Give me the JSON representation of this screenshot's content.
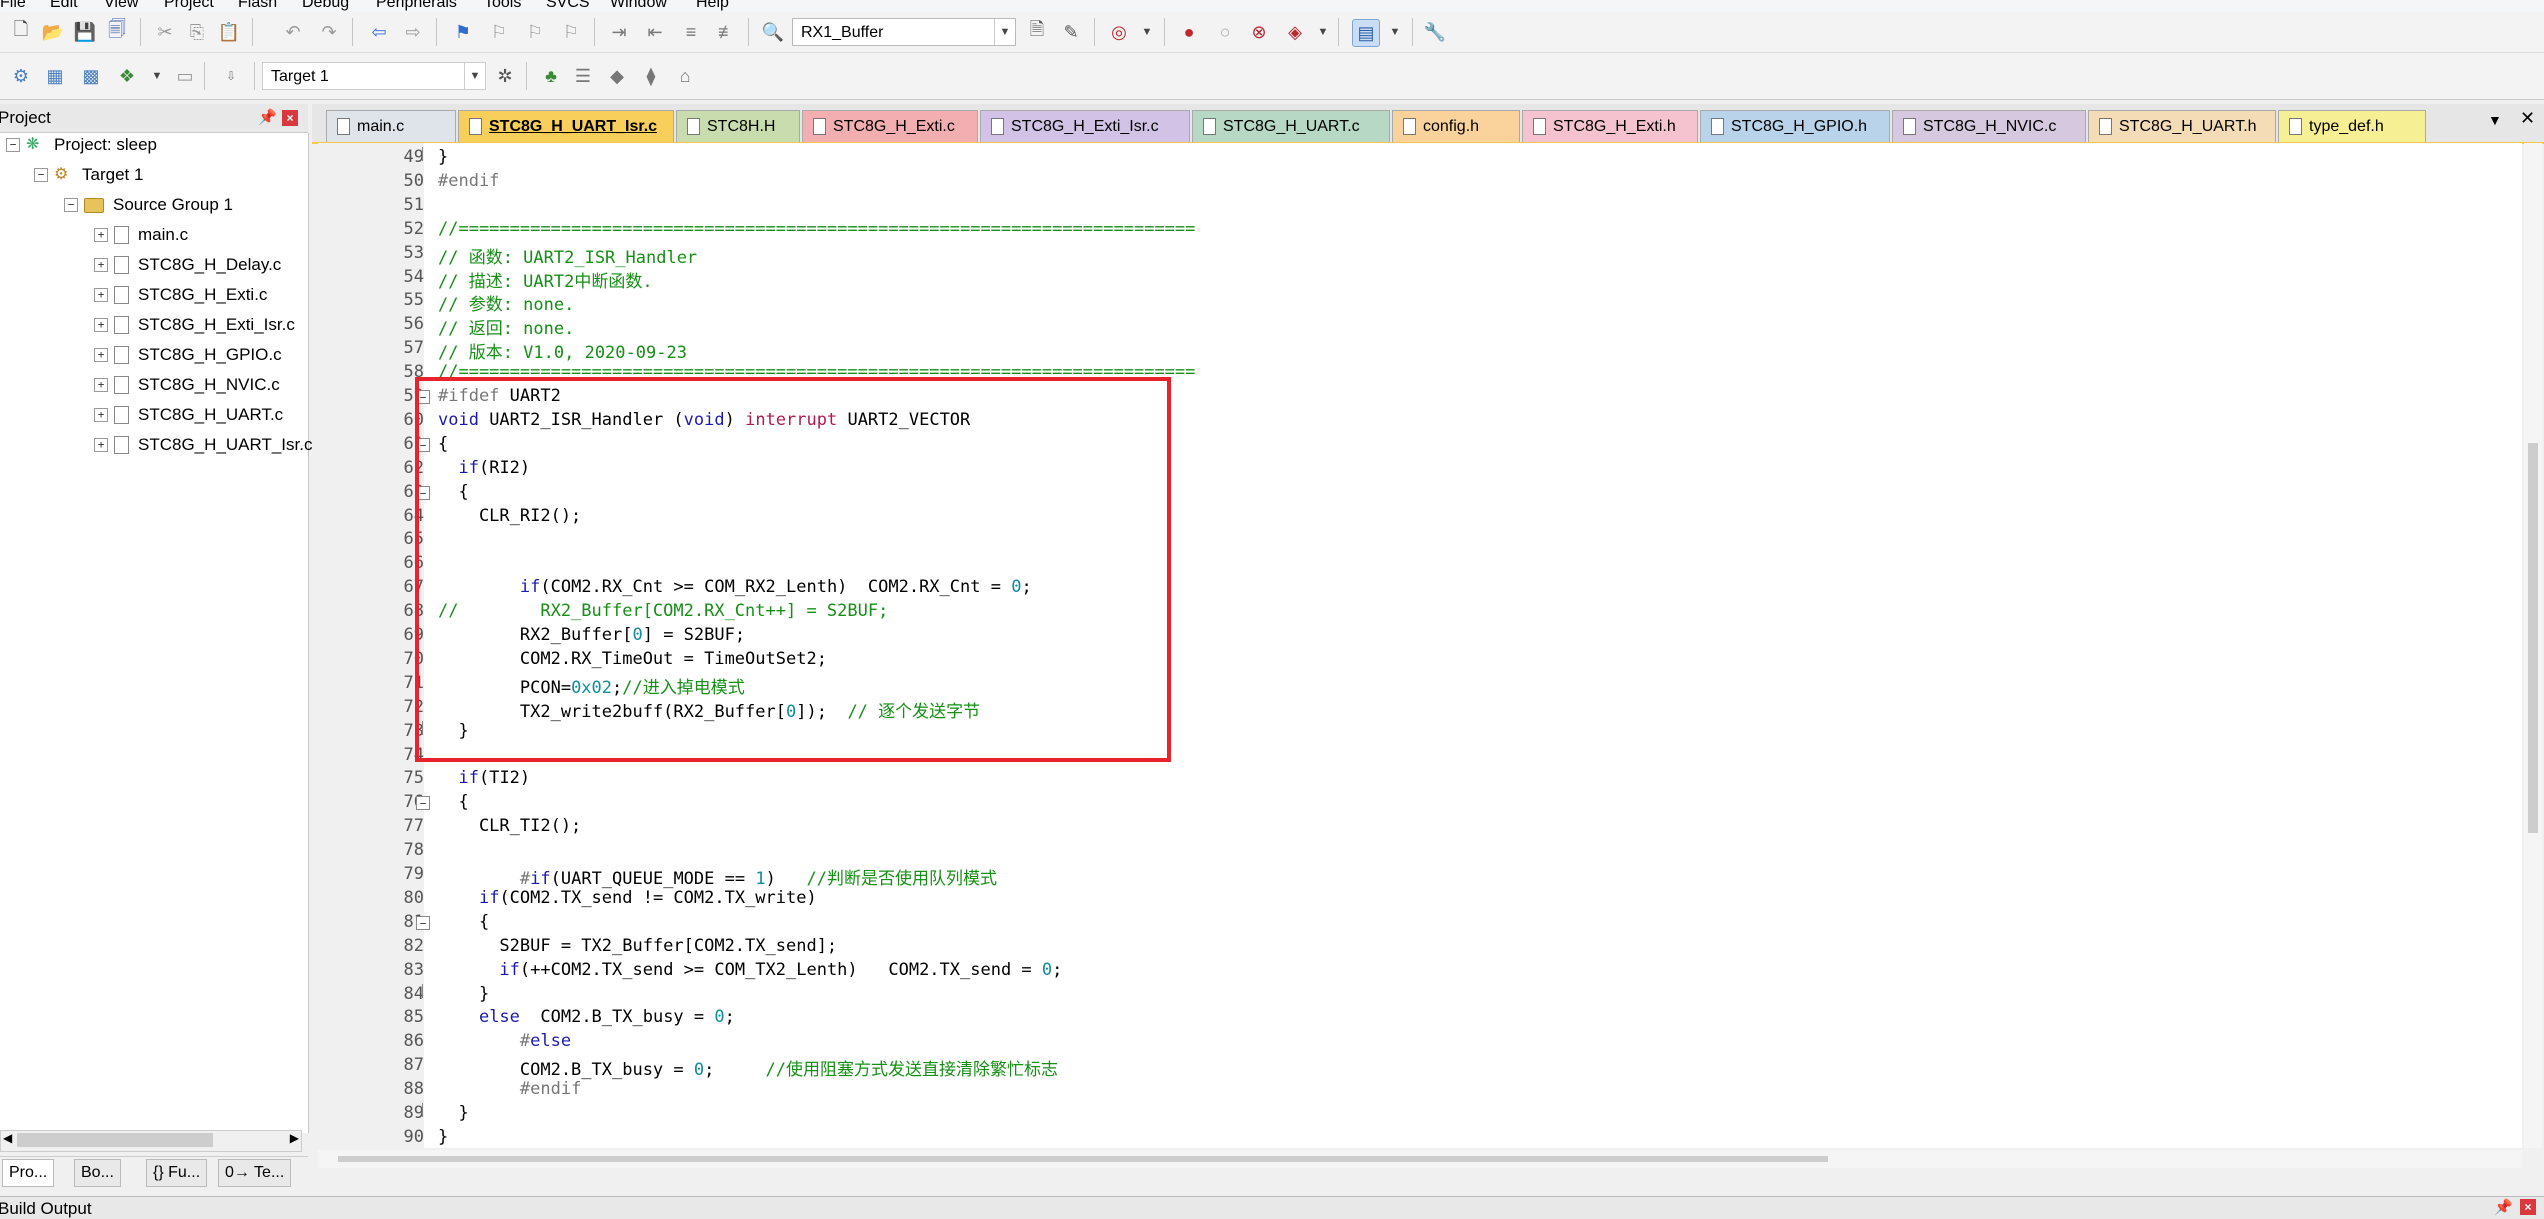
{
  "menu": [
    "File",
    "Edit",
    "View",
    "Project",
    "Flash",
    "Debug",
    "Peripherals",
    "Tools",
    "SVCS",
    "Window",
    "Help"
  ],
  "toolbar": {
    "find_combo_value": "RX1_Buffer",
    "target_combo_value": "Target 1"
  },
  "project_panel": {
    "title": "Project",
    "tree": [
      {
        "label": "Project: sleep",
        "kind": "project",
        "level": 0
      },
      {
        "label": "Target 1",
        "kind": "target",
        "level": 1
      },
      {
        "label": "Source Group 1",
        "kind": "group",
        "level": 2
      },
      {
        "label": "main.c",
        "kind": "file",
        "level": 3
      },
      {
        "label": "STC8G_H_Delay.c",
        "kind": "file",
        "level": 3
      },
      {
        "label": "STC8G_H_Exti.c",
        "kind": "file",
        "level": 3
      },
      {
        "label": "STC8G_H_Exti_Isr.c",
        "kind": "file",
        "level": 3
      },
      {
        "label": "STC8G_H_GPIO.c",
        "kind": "file",
        "level": 3
      },
      {
        "label": "STC8G_H_NVIC.c",
        "kind": "file",
        "level": 3
      },
      {
        "label": "STC8G_H_UART.c",
        "kind": "file",
        "level": 3
      },
      {
        "label": "STC8G_H_UART_Isr.c",
        "kind": "file",
        "level": 3
      }
    ],
    "bottom_tabs": [
      "Pro...",
      "Bo...",
      "{} Fu...",
      "0→ Te..."
    ]
  },
  "editor_tabs": [
    {
      "label": "main.c",
      "color": "#dfe3ea",
      "active": false
    },
    {
      "label": "STC8G_H_UART_Isr.c",
      "color": "#f7cf5a",
      "active": true
    },
    {
      "label": "STC8H.H",
      "color": "#c9dcae",
      "active": false
    },
    {
      "label": "STC8G_H_Exti.c",
      "color": "#f2aeb0",
      "active": false
    },
    {
      "label": "STC8G_H_Exti_Isr.c",
      "color": "#d2c2e6",
      "active": false
    },
    {
      "label": "STC8G_H_UART.c",
      "color": "#b7d8c4",
      "active": false
    },
    {
      "label": "config.h",
      "color": "#f9d29c",
      "active": false
    },
    {
      "label": "STC8G_H_Exti.h",
      "color": "#f4c3cf",
      "active": false
    },
    {
      "label": "STC8G_H_GPIO.h",
      "color": "#b9d3ea",
      "active": false
    },
    {
      "label": "STC8G_H_NVIC.c",
      "color": "#d6c8df",
      "active": false
    },
    {
      "label": "STC8G_H_UART.h",
      "color": "#f4dcb6",
      "active": false
    },
    {
      "label": "type_def.h",
      "color": "#f6ef93",
      "active": false
    }
  ],
  "code_lines": [
    {
      "n": "49",
      "t": "}"
    },
    {
      "n": "50",
      "t": "#endif"
    },
    {
      "n": "51",
      "t": ""
    },
    {
      "n": "52",
      "t": "//========================================================================"
    },
    {
      "n": "53",
      "t": "// 函数: UART2_ISR_Handler"
    },
    {
      "n": "54",
      "t": "// 描述: UART2中断函数."
    },
    {
      "n": "55",
      "t": "// 参数: none."
    },
    {
      "n": "56",
      "t": "// 返回: none."
    },
    {
      "n": "57",
      "t": "// 版本: V1.0, 2020-09-23"
    },
    {
      "n": "58",
      "t": "//========================================================================"
    },
    {
      "n": "59",
      "t": "#ifdef UART2"
    },
    {
      "n": "60",
      "t": "void UART2_ISR_Handler (void) interrupt UART2_VECTOR"
    },
    {
      "n": "61",
      "t": "{"
    },
    {
      "n": "62",
      "t": "  if(RI2)"
    },
    {
      "n": "63",
      "t": "  {"
    },
    {
      "n": "64",
      "t": "    CLR_RI2();"
    },
    {
      "n": "65",
      "t": ""
    },
    {
      "n": "66",
      "t": ""
    },
    {
      "n": "67",
      "t": "        if(COM2.RX_Cnt >= COM_RX2_Lenth)  COM2.RX_Cnt = 0;"
    },
    {
      "n": "68",
      "t": "//        RX2_Buffer[COM2.RX_Cnt++] = S2BUF;"
    },
    {
      "n": "69",
      "t": "        RX2_Buffer[0] = S2BUF;"
    },
    {
      "n": "70",
      "t": "        COM2.RX_TimeOut = TimeOutSet2;"
    },
    {
      "n": "71",
      "t": "        PCON=0x02;//进入掉电模式"
    },
    {
      "n": "72",
      "t": "        TX2_write2buff(RX2_Buffer[0]);  // 逐个发送字节"
    },
    {
      "n": "73",
      "t": "  }"
    },
    {
      "n": "74",
      "t": ""
    },
    {
      "n": "75",
      "t": "  if(TI2)"
    },
    {
      "n": "76",
      "t": "  {"
    },
    {
      "n": "77",
      "t": "    CLR_TI2();"
    },
    {
      "n": "78",
      "t": ""
    },
    {
      "n": "79",
      "t": "        #if(UART_QUEUE_MODE == 1)   //判断是否使用队列模式"
    },
    {
      "n": "80",
      "t": "    if(COM2.TX_send != COM2.TX_write)"
    },
    {
      "n": "81",
      "t": "    {"
    },
    {
      "n": "82",
      "t": "      S2BUF = TX2_Buffer[COM2.TX_send];"
    },
    {
      "n": "83",
      "t": "      if(++COM2.TX_send >= COM_TX2_Lenth)   COM2.TX_send = 0;"
    },
    {
      "n": "84",
      "t": "    }"
    },
    {
      "n": "85",
      "t": "    else  COM2.B_TX_busy = 0;"
    },
    {
      "n": "86",
      "t": "        #else"
    },
    {
      "n": "87",
      "t": "        COM2.B_TX_busy = 0;     //使用阻塞方式发送直接清除繁忙标志"
    },
    {
      "n": "88",
      "t": "        #endif"
    },
    {
      "n": "89",
      "t": "  }"
    },
    {
      "n": "90",
      "t": "}"
    }
  ],
  "build_output": {
    "title": "Build Output"
  }
}
